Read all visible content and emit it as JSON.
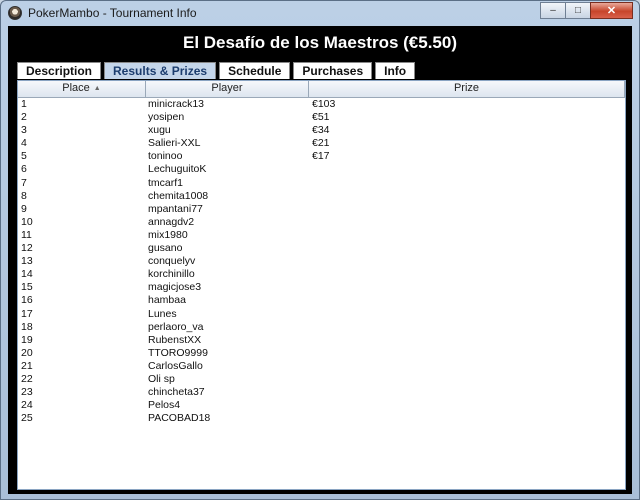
{
  "window": {
    "title": "PokerMambo - Tournament Info",
    "controls": {
      "minimize": "‒",
      "maximize": "□",
      "close": "✕"
    }
  },
  "heading": "El Desafío de los Maestros (€5.50)",
  "tabs": [
    {
      "label": "Description",
      "active": false
    },
    {
      "label": "Results & Prizes",
      "active": true
    },
    {
      "label": "Schedule",
      "active": false
    },
    {
      "label": "Purchases",
      "active": false
    },
    {
      "label": "Info",
      "active": false
    }
  ],
  "table": {
    "columns": [
      "Place",
      "Player",
      "Prize"
    ],
    "sort_icon": "▲",
    "rows": [
      {
        "place": "1",
        "player": "minicrack13",
        "prize": "€103"
      },
      {
        "place": "2",
        "player": "yosipen",
        "prize": "€51"
      },
      {
        "place": "3",
        "player": "xugu",
        "prize": "€34"
      },
      {
        "place": "4",
        "player": "Salieri-XXL",
        "prize": "€21"
      },
      {
        "place": "5",
        "player": "toninoo",
        "prize": "€17"
      },
      {
        "place": "6",
        "player": "LechuguitoK",
        "prize": ""
      },
      {
        "place": "7",
        "player": "tmcarf1",
        "prize": ""
      },
      {
        "place": "8",
        "player": "chemita1008",
        "prize": ""
      },
      {
        "place": "9",
        "player": "mpantani77",
        "prize": ""
      },
      {
        "place": "10",
        "player": "annagdv2",
        "prize": ""
      },
      {
        "place": "11",
        "player": "mix1980",
        "prize": ""
      },
      {
        "place": "12",
        "player": "gusano",
        "prize": ""
      },
      {
        "place": "13",
        "player": "conquelyv",
        "prize": ""
      },
      {
        "place": "14",
        "player": "korchinillo",
        "prize": ""
      },
      {
        "place": "15",
        "player": "magicjose3",
        "prize": ""
      },
      {
        "place": "16",
        "player": "hambaa",
        "prize": ""
      },
      {
        "place": "17",
        "player": "Lunes",
        "prize": ""
      },
      {
        "place": "18",
        "player": "perlaoro_va",
        "prize": ""
      },
      {
        "place": "19",
        "player": "RubenstXX",
        "prize": ""
      },
      {
        "place": "20",
        "player": "TTORO9999",
        "prize": ""
      },
      {
        "place": "21",
        "player": "CarlosGallo",
        "prize": ""
      },
      {
        "place": "22",
        "player": "Oli sp",
        "prize": ""
      },
      {
        "place": "23",
        "player": "chincheta37",
        "prize": ""
      },
      {
        "place": "24",
        "player": "Pelos4",
        "prize": ""
      },
      {
        "place": "25",
        "player": "PACOBAD18",
        "prize": ""
      }
    ]
  }
}
